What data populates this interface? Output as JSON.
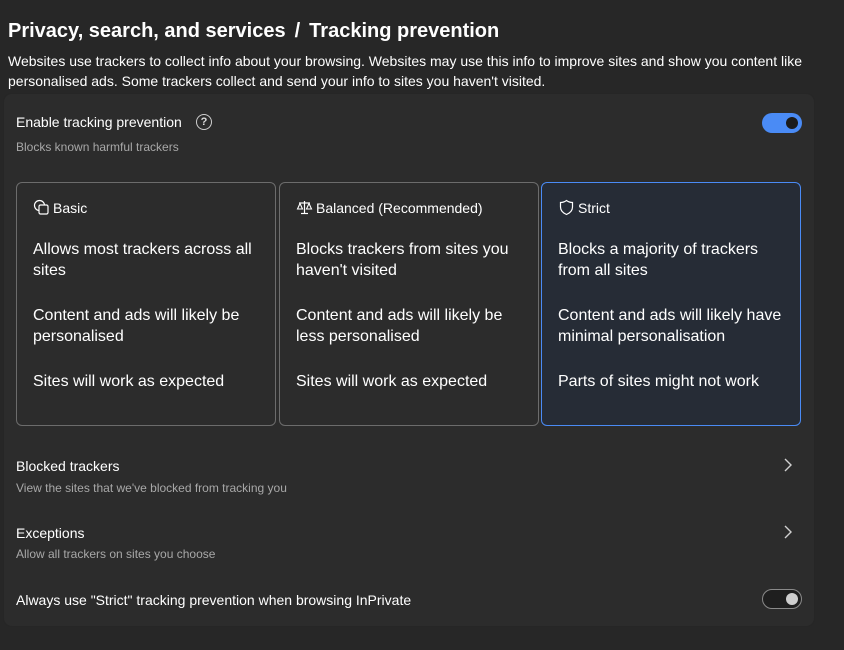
{
  "header": {
    "breadcrumb_parent": "Privacy, search, and services",
    "breadcrumb_separator": "/",
    "breadcrumb_current": "Tracking prevention",
    "description": "Websites use trackers to collect info about your browsing. Websites may use this info to improve sites and show you content like personalised ads. Some trackers collect and send your info to sites you haven't visited."
  },
  "enable": {
    "title": "Enable tracking prevention",
    "subtitle": "Blocks known harmful trackers",
    "help_glyph": "?",
    "toggle_on": true
  },
  "levels": [
    {
      "label": "Basic",
      "icon": "basic-shapes-icon",
      "lines": [
        "Allows most trackers across all sites",
        "Content and ads will likely be personalised",
        "Sites will work as expected"
      ],
      "selected": false
    },
    {
      "label": "Balanced (Recommended)",
      "icon": "scales-icon",
      "lines": [
        "Blocks trackers from sites you haven't visited",
        "Content and ads will likely be less personalised",
        "Sites will work as expected"
      ],
      "selected": false
    },
    {
      "label": "Strict",
      "icon": "shield-icon",
      "lines": [
        "Blocks a majority of trackers from all sites",
        "Content and ads will likely have minimal personalisation",
        "Parts of sites might not work"
      ],
      "selected": true
    }
  ],
  "blocked": {
    "title": "Blocked trackers",
    "subtitle": "View the sites that we've blocked from tracking you"
  },
  "exceptions": {
    "title": "Exceptions",
    "subtitle": "Allow all trackers on sites you choose"
  },
  "inprivate": {
    "title": "Always use \"Strict\" tracking prevention when browsing InPrivate",
    "toggle_on": false
  },
  "colors": {
    "background": "#272727",
    "card": "#2c2c2c",
    "accent": "#4a8bf5",
    "secondary_text": "#a8a8a8"
  }
}
